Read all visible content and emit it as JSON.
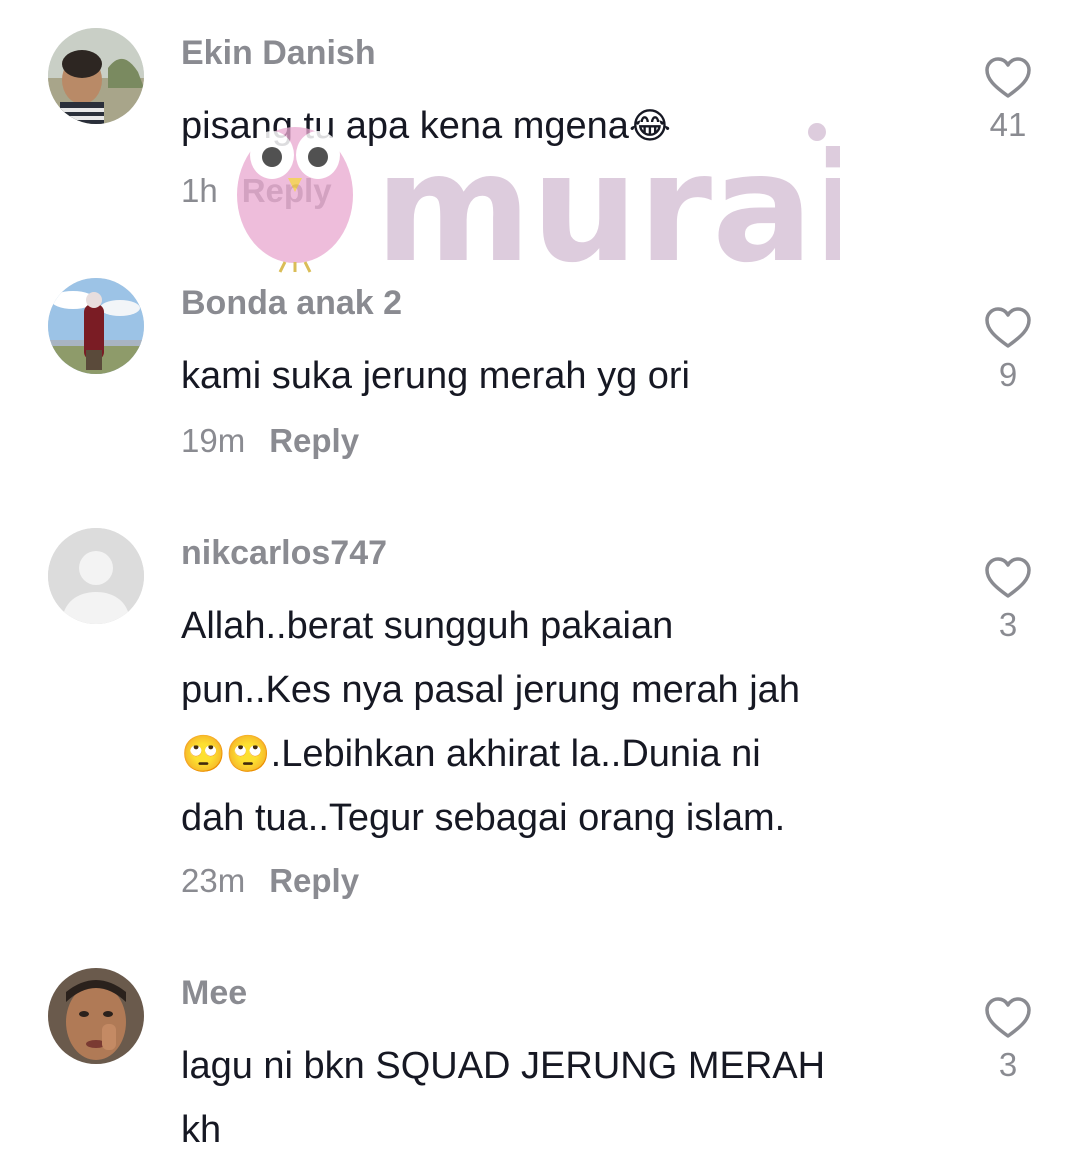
{
  "comments": [
    {
      "username": "Ekin Danish",
      "text": "pisang tu apa kena mgena",
      "emoji": "😂",
      "time": "1h",
      "reply_label": "Reply",
      "likes": "41",
      "avatar_icon": "child-photo-avatar"
    },
    {
      "username": "Bonda anak 2",
      "text": "kami suka jerung merah yg ori",
      "time": "19m",
      "reply_label": "Reply",
      "likes": "9",
      "avatar_icon": "landscape-photo-avatar"
    },
    {
      "username": "nikcarlos747",
      "text_line1": "Allah..berat sungguh pakaian",
      "text_line2": "pun..Kes nya pasal jerung merah jah",
      "text_line3_emoji": "🙄🙄",
      "text_line3": ".Lebihkan akhirat la..Dunia ni",
      "text_line4": "dah tua..Tegur sebagai orang islam.",
      "time": "23m",
      "reply_label": "Reply",
      "likes": "3",
      "avatar_icon": "default-user-avatar"
    },
    {
      "username": "Mee",
      "text_line1": "lagu ni bkn SQUAD JERUNG MERAH",
      "text_line2": "kh",
      "likes": "3",
      "avatar_icon": "face-photo-avatar"
    }
  ],
  "watermark": {
    "text": "murai",
    "logo_icon": "owl-bird-logo"
  },
  "colors": {
    "text": "#161823",
    "muted": "#8a8b91",
    "watermark": "#d8c4d8"
  }
}
